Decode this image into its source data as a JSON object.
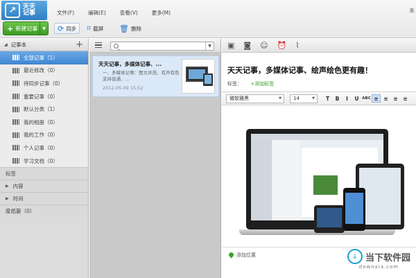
{
  "app": {
    "logo_text": "天天记事",
    "logo_mark": "↗"
  },
  "menu": [
    "文件(F)",
    "编辑(E)",
    "查看(V)",
    "更多(M)"
  ],
  "corner_text": "未",
  "toolbar": {
    "new_label": "新建记事",
    "sync_label": "同步",
    "screenshot_label": "截屏",
    "delete_label": "删除"
  },
  "sidebar": {
    "header": "记事本",
    "items": [
      {
        "label": "全部记事（1）",
        "active": true
      },
      {
        "label": "最近修改（0）"
      },
      {
        "label": "待同步记事（0）"
      },
      {
        "label": "重要记事（0）"
      },
      {
        "label": "默认分类（1）"
      },
      {
        "label": "我的相册（0）"
      },
      {
        "label": "我的工作（0）"
      },
      {
        "label": "个人记事（0）"
      },
      {
        "label": "学习文档（0）"
      }
    ],
    "groups": [
      "标签",
      "内容",
      "时间",
      "废纸篓（0）"
    ]
  },
  "notelist": {
    "search_placeholder": "",
    "note": {
      "title": "天天记事，多媒体记事、...",
      "snippet": "一、多媒体记事：图文并茂、有声有色 支持普通、...",
      "date": "2012-05-09 15:52"
    }
  },
  "editor": {
    "title": "天天记事，多媒体记事、绘声绘色更有趣！",
    "tags_label": "标签：",
    "add_tag": "+添加标签",
    "font": "微软雅黑",
    "size": "14",
    "format_buttons": [
      "T",
      "B",
      "I",
      "U",
      "ABC",
      "≡",
      "≡",
      "≡",
      "≡"
    ],
    "location": "添加位置"
  },
  "watermark": {
    "text": "当下软件园",
    "url": "downxia.com"
  }
}
